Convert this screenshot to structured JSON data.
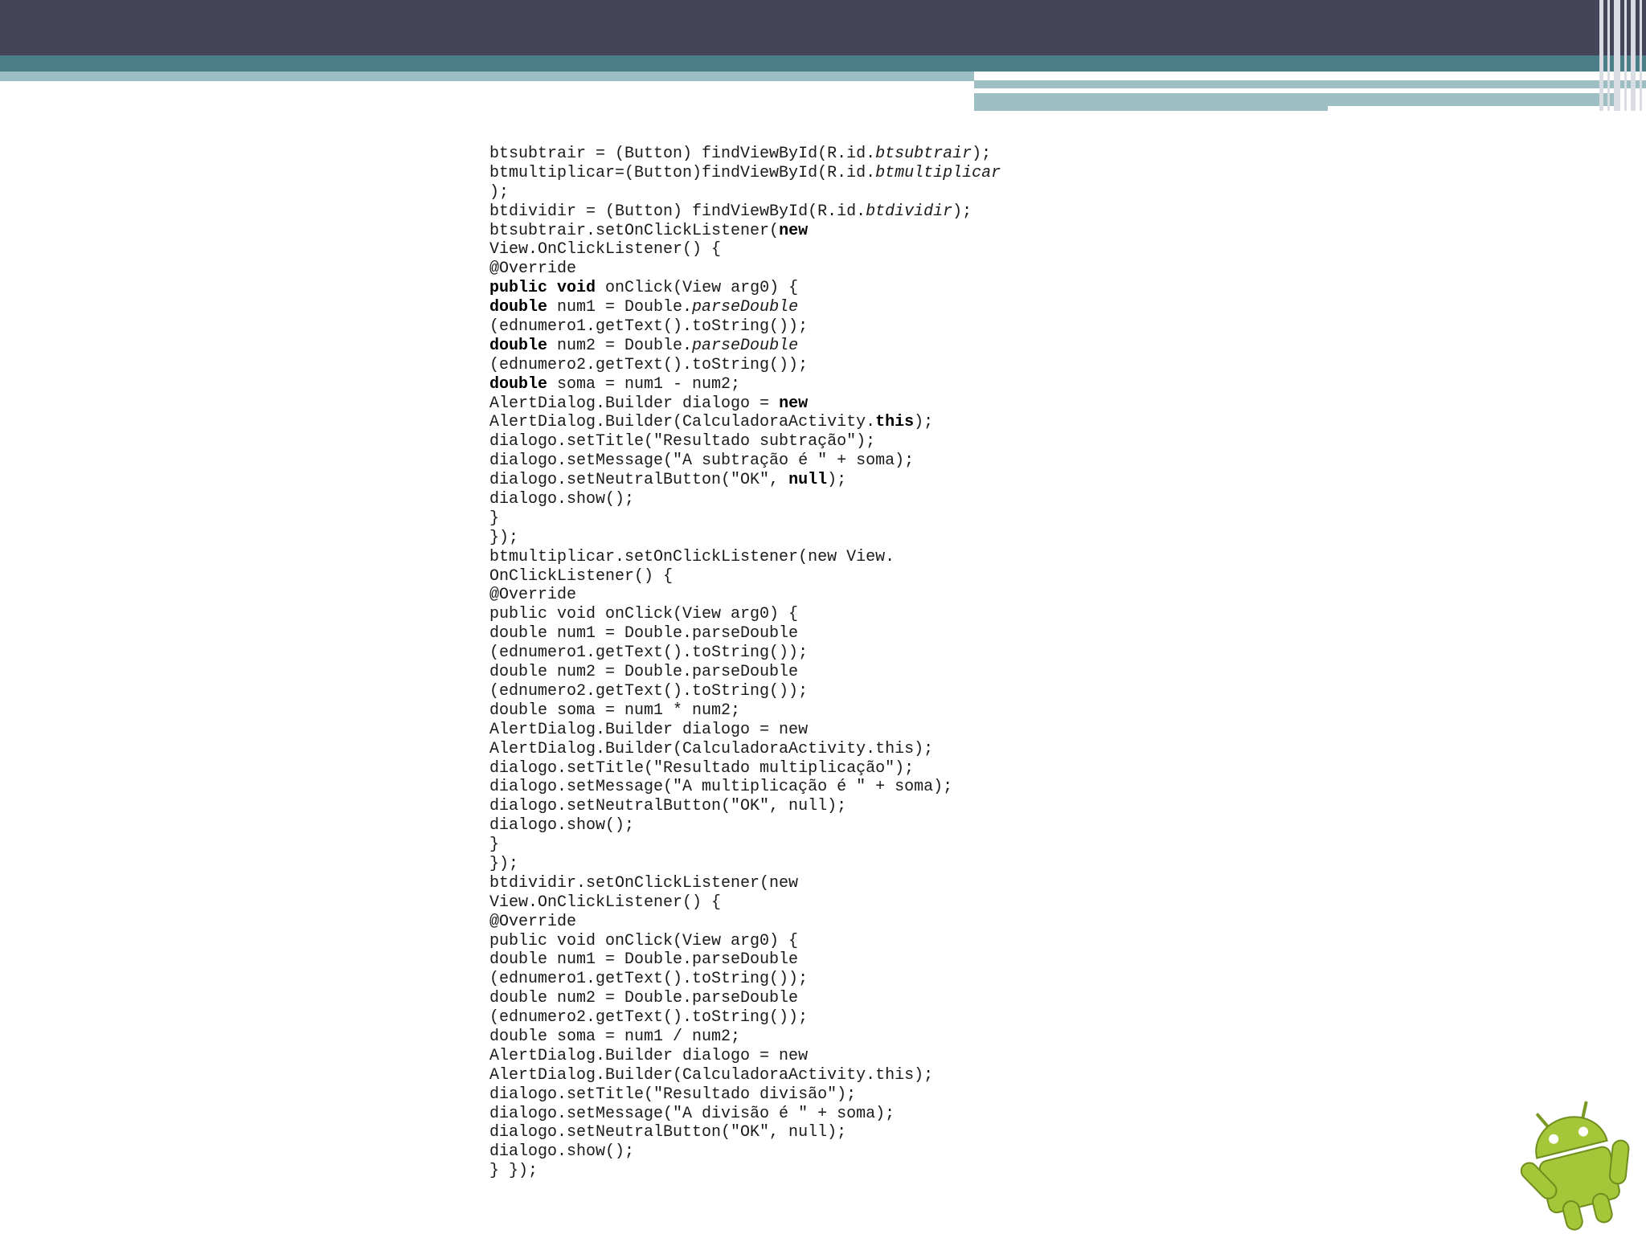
{
  "slide": {
    "code_lines": [
      [
        {
          "t": "btsubtrair = (Button) findViewById(R.id."
        },
        {
          "t": "btsubtrair",
          "s": "i"
        },
        {
          "t": ");"
        }
      ],
      [
        {
          "t": "btmultiplicar=(Button)findViewById(R.id."
        },
        {
          "t": "btmultiplicar",
          "s": "i"
        }
      ],
      [
        {
          "t": ");"
        }
      ],
      [
        {
          "t": "btdividir = (Button) findViewById(R.id."
        },
        {
          "t": "btdividir",
          "s": "i"
        },
        {
          "t": ");"
        }
      ],
      [
        {
          "t": "btsubtrair.setOnClickListener("
        },
        {
          "t": "new",
          "s": "b"
        }
      ],
      [
        {
          "t": "View.OnClickListener() {"
        }
      ],
      [
        {
          "t": "@Override"
        }
      ],
      [
        {
          "t": "public",
          "s": "b"
        },
        {
          "t": " "
        },
        {
          "t": "void",
          "s": "b"
        },
        {
          "t": " onClick(View arg0) {"
        }
      ],
      [
        {
          "t": "double",
          "s": "b"
        },
        {
          "t": " num1 = Double."
        },
        {
          "t": "parseDouble",
          "s": "i"
        }
      ],
      [
        {
          "t": "(ednumero1.getText().toString());"
        }
      ],
      [
        {
          "t": "double",
          "s": "b"
        },
        {
          "t": " num2 = Double."
        },
        {
          "t": "parseDouble",
          "s": "i"
        }
      ],
      [
        {
          "t": "(ednumero2.getText().toString());"
        }
      ],
      [
        {
          "t": "double",
          "s": "b"
        },
        {
          "t": " soma = num1 - num2;"
        }
      ],
      [
        {
          "t": "AlertDialog.Builder dialogo = "
        },
        {
          "t": "new",
          "s": "b"
        }
      ],
      [
        {
          "t": "AlertDialog.Builder(CalculadoraActivity."
        },
        {
          "t": "this",
          "s": "b"
        },
        {
          "t": ");"
        }
      ],
      [
        {
          "t": "dialogo.setTitle(\"Resultado subtração\");"
        }
      ],
      [
        {
          "t": "dialogo.setMessage(\"A subtração é \" + soma);"
        }
      ],
      [
        {
          "t": "dialogo.setNeutralButton(\"OK\", "
        },
        {
          "t": "null",
          "s": "b"
        },
        {
          "t": ");"
        }
      ],
      [
        {
          "t": "dialogo.show();"
        }
      ],
      [
        {
          "t": "}"
        }
      ],
      [
        {
          "t": "});"
        }
      ],
      [
        {
          "t": "btmultiplicar.setOnClickListener(new View."
        }
      ],
      [
        {
          "t": "OnClickListener() {"
        }
      ],
      [
        {
          "t": "@Override"
        }
      ],
      [
        {
          "t": "public void onClick(View arg0) {"
        }
      ],
      [
        {
          "t": "double num1 = Double.parseDouble"
        }
      ],
      [
        {
          "t": "(ednumero1.getText().toString());"
        }
      ],
      [
        {
          "t": "double num2 = Double.parseDouble"
        }
      ],
      [
        {
          "t": "(ednumero2.getText().toString());"
        }
      ],
      [
        {
          "t": "double soma = num1 * num2;"
        }
      ],
      [
        {
          "t": "AlertDialog.Builder dialogo = new"
        }
      ],
      [
        {
          "t": "AlertDialog.Builder(CalculadoraActivity.this);"
        }
      ],
      [
        {
          "t": "dialogo.setTitle(\"Resultado multiplicação\");"
        }
      ],
      [
        {
          "t": "dialogo.setMessage(\"A multiplicação é \" + soma);"
        }
      ],
      [
        {
          "t": "dialogo.setNeutralButton(\"OK\", null);"
        }
      ],
      [
        {
          "t": "dialogo.show();"
        }
      ],
      [
        {
          "t": "}"
        }
      ],
      [
        {
          "t": "});"
        }
      ],
      [
        {
          "t": "btdividir.setOnClickListener(new"
        }
      ],
      [
        {
          "t": "View.OnClickListener() {"
        }
      ],
      [
        {
          "t": "@Override"
        }
      ],
      [
        {
          "t": "public void onClick(View arg0) {"
        }
      ],
      [
        {
          "t": "double num1 = Double.parseDouble"
        }
      ],
      [
        {
          "t": "(ednumero1.getText().toString());"
        }
      ],
      [
        {
          "t": "double num2 = Double.parseDouble"
        }
      ],
      [
        {
          "t": "(ednumero2.getText().toString());"
        }
      ],
      [
        {
          "t": "double soma = num1 / num2;"
        }
      ],
      [
        {
          "t": "AlertDialog.Builder dialogo = new"
        }
      ],
      [
        {
          "t": "AlertDialog.Builder(CalculadoraActivity.this);"
        }
      ],
      [
        {
          "t": "dialogo.setTitle(\"Resultado divisão\");"
        }
      ],
      [
        {
          "t": "dialogo.setMessage(\"A divisão é \" + soma);"
        }
      ],
      [
        {
          "t": "dialogo.setNeutralButton(\"OK\", null);"
        }
      ],
      [
        {
          "t": "dialogo.show();"
        }
      ],
      [
        {
          "t": "} });"
        }
      ]
    ],
    "mascot_icon": "android-robot-icon",
    "colors": {
      "header_dark": "#45455a",
      "header_teal": "#4b7f87",
      "header_light": "#9dbfc3",
      "android_green": "#a4c639"
    }
  }
}
